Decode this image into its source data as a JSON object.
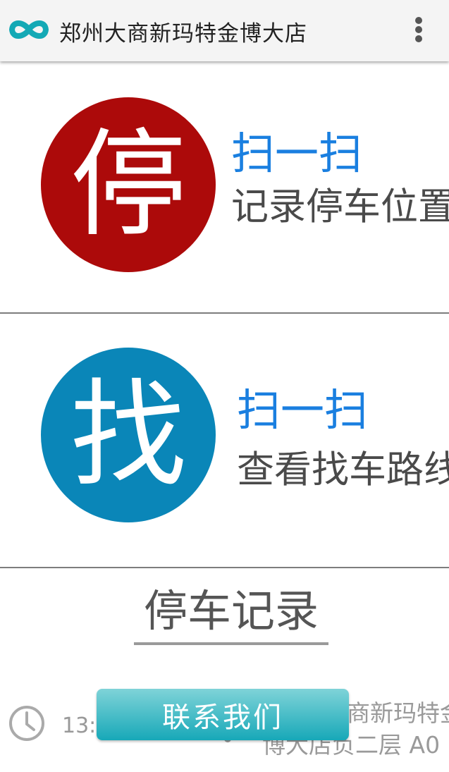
{
  "header": {
    "title": "郑州大商新玛特金博大店",
    "logo_icon": "infinity-logo-icon",
    "menu_icon": "more-vertical-icon",
    "logo_color": "#14a9b5"
  },
  "park_action": {
    "icon_char": "停",
    "scan_label": "扫一扫",
    "description": "记录停车位置",
    "color": "#ac0a0a"
  },
  "find_action": {
    "icon_char": "找",
    "scan_label": "扫一扫",
    "description": "查看找车路线",
    "color": "#0a86b8"
  },
  "records": {
    "title": "停车记录",
    "items": [
      {
        "time": "13:",
        "store": "商新玛特金",
        "location": "博大店负二层 A0"
      }
    ]
  },
  "contact_button": {
    "label": "联系我们"
  },
  "colors": {
    "accent_blue": "#1a7fe0",
    "button_teal": "#17a8b8"
  }
}
